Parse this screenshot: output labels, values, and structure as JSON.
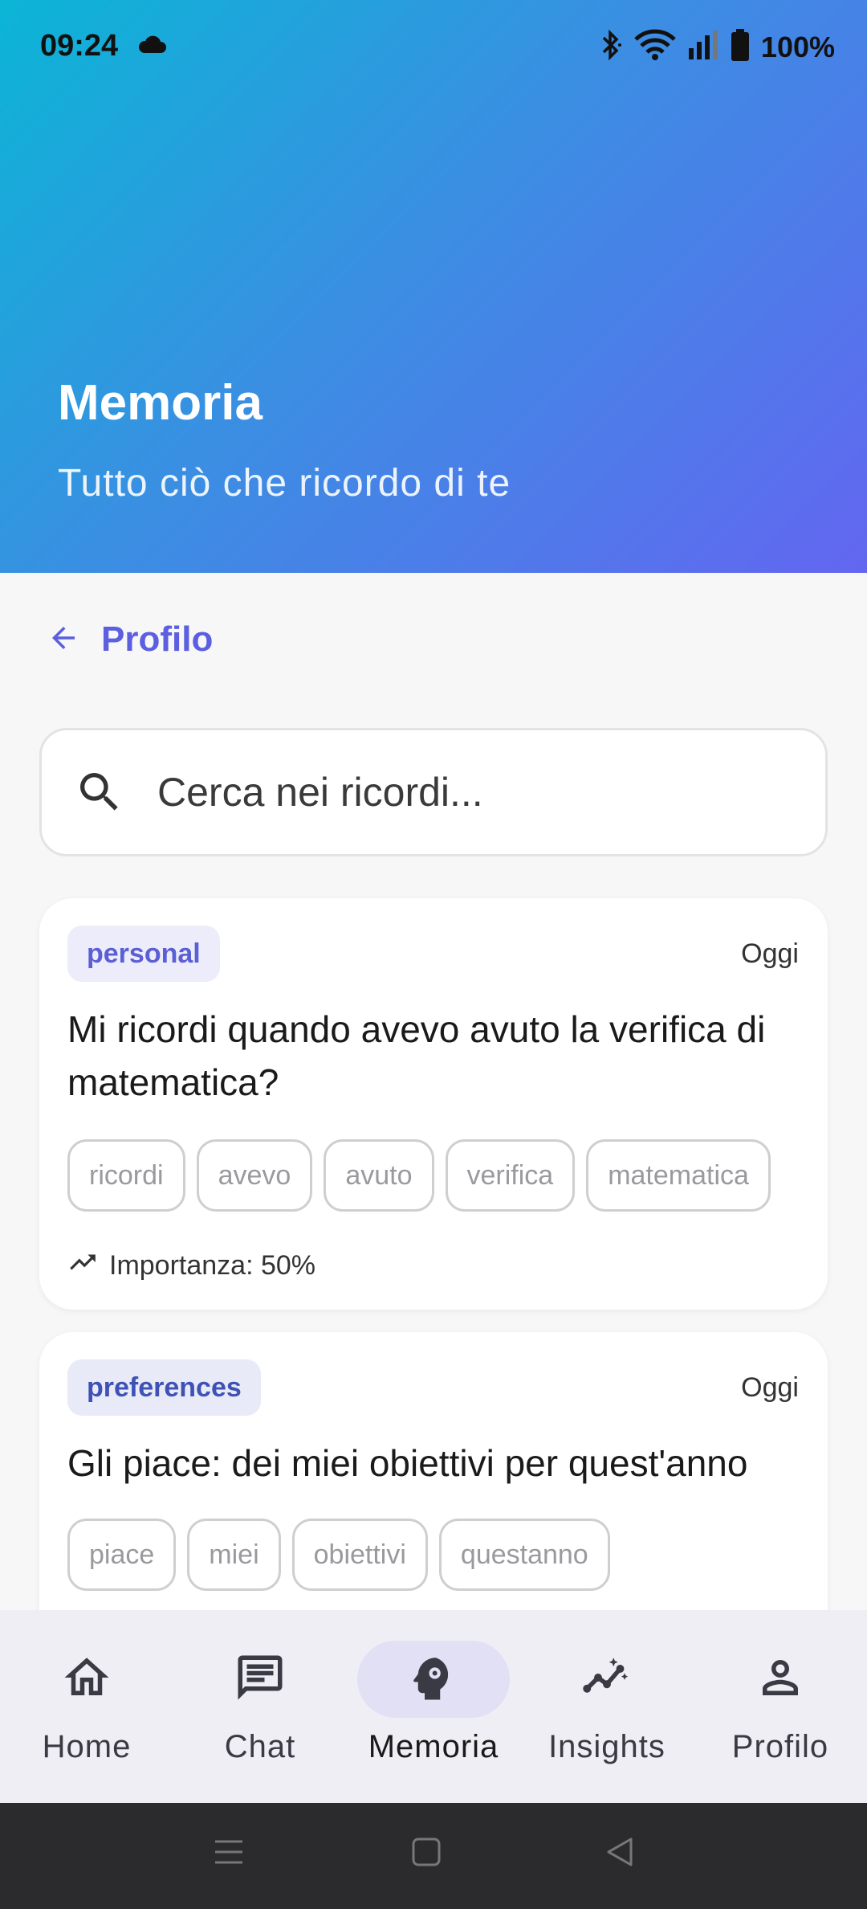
{
  "status_bar": {
    "time": "09:24",
    "battery": "100%"
  },
  "header": {
    "title": "Memoria",
    "subtitle": "Tutto ciò che ricordo di te"
  },
  "back": {
    "label": "Profilo"
  },
  "search": {
    "placeholder": "Cerca nei ricordi..."
  },
  "memories": [
    {
      "category": "personal",
      "date": "Oggi",
      "text": "Mi ricordi quando avevo avuto la verifica di matematica?",
      "tags": [
        "ricordi",
        "avevo",
        "avuto",
        "verifica",
        "matematica"
      ],
      "importance": "Importanza: 50%"
    },
    {
      "category": "preferences",
      "date": "Oggi",
      "text": "Gli piace: dei miei obiettivi per quest'anno",
      "tags": [
        "piace",
        "miei",
        "obiettivi",
        "questanno"
      ]
    }
  ],
  "nav": {
    "items": [
      {
        "label": "Home",
        "icon": "home-icon"
      },
      {
        "label": "Chat",
        "icon": "chat-icon"
      },
      {
        "label": "Memoria",
        "icon": "psychology-icon",
        "active": true
      },
      {
        "label": "Insights",
        "icon": "insights-icon"
      },
      {
        "label": "Profilo",
        "icon": "person-icon"
      }
    ]
  },
  "colors": {
    "accent": "#5b5fe0",
    "gradient_start": "#0bb5d6",
    "gradient_end": "#6366f1"
  }
}
